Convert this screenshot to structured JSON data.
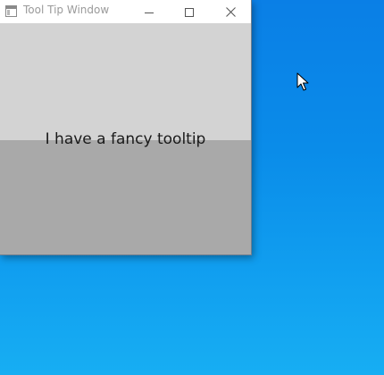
{
  "window": {
    "title": "Tool Tip Window",
    "controls": {
      "minimize_icon": "minimize-icon",
      "maximize_icon": "maximize-icon",
      "close_icon": "close-icon"
    }
  },
  "content": {
    "label": "I have a fancy tooltip",
    "top_pane_color": "#d3d3d3",
    "bottom_pane_color": "#a9a9a9"
  },
  "desktop": {
    "background_color": "#0a8ce9",
    "cursor_icon": "arrow-cursor-icon"
  }
}
